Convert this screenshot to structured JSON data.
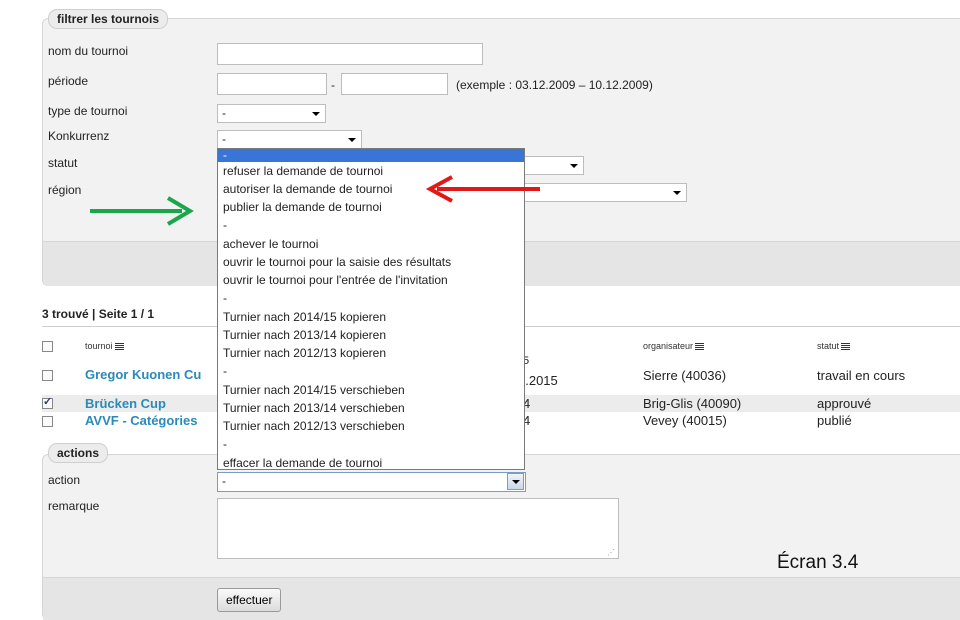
{
  "filter": {
    "legend": "filtrer les tournois",
    "labels": {
      "name": "nom du tournoi",
      "period": "période",
      "type": "type de tournoi",
      "konkurrenz": "Konkurrenz",
      "status": "statut",
      "region": "région"
    },
    "period_separator": "-",
    "period_example": "(exemple : 03.12.2009 – 10.12.2009)",
    "type_value": "-",
    "konkurrenz_value": "-"
  },
  "results": {
    "summary": "3 trouvé | Seite 1 / 1",
    "columns": {
      "tournoi": "tournoi",
      "organisateur": "organisateur",
      "statut": "statut"
    },
    "rows": [
      {
        "name": "Gregor Kuonen Cu",
        "date_top": "5",
        "date": "4.2015",
        "organisateur": "Sierre (40036)",
        "statut": "travail en cours",
        "checked": false
      },
      {
        "name": "Brücken Cup",
        "date": "4",
        "organisateur": "Brig-Glis (40090)",
        "statut": "approuvé",
        "checked": true
      },
      {
        "name": "AVVF - Catégories",
        "date": "4",
        "organisateur": "Vevey (40015)",
        "statut": "publié",
        "checked": false
      }
    ]
  },
  "dropdown": {
    "options": [
      "-",
      "refuser la demande de tournoi",
      "autoriser la demande de tournoi",
      "publier la demande de tournoi",
      "-",
      "achever le tournoi",
      "ouvrir le tournoi pour la saisie des résultats",
      "ouvrir le tournoi pour l'entrée de l'invitation",
      "-",
      "Turnier nach 2014/15 kopieren",
      "Turnier nach 2013/14 kopieren",
      "Turnier nach 2012/13 kopieren",
      "-",
      "Turnier nach 2014/15 verschieben",
      "Turnier nach 2013/14 verschieben",
      "Turnier nach 2012/13 verschieben",
      "-",
      "effacer la demande de tournoi"
    ]
  },
  "actions": {
    "legend": "actions",
    "action_label": "action",
    "action_value": "-",
    "remark_label": "remarque",
    "submit_label": "effectuer"
  },
  "caption": "Écran 3.4",
  "colors": {
    "link": "#2a8ab8",
    "highlight": "#3875d7",
    "green_arrow": "#1aa64a",
    "red_arrow": "#e01818"
  }
}
